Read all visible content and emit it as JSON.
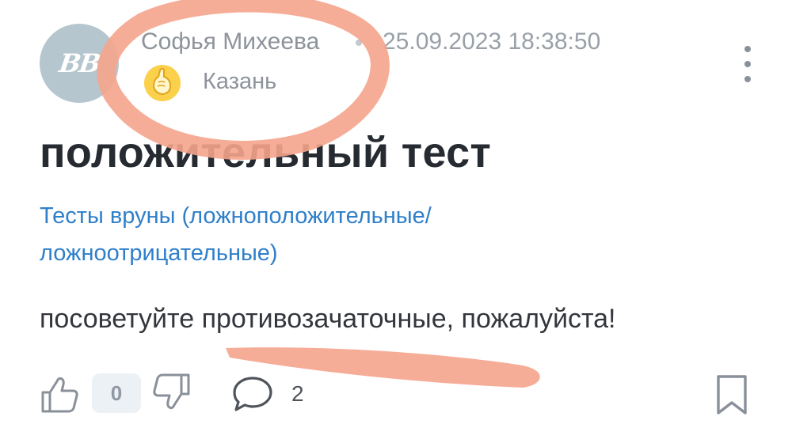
{
  "post": {
    "author": {
      "initials": "BB",
      "name": "Софья Михеева",
      "city": "Казань",
      "city_icon": "hand-emoji-icon"
    },
    "date": "25.09.2023 18:38:50",
    "title": "положительный тест",
    "category": "Тесты вруны (ложноположительные/ ложноотрицательные)",
    "body": "посоветуйте противозачаточные, пожалуйста!"
  },
  "actions": {
    "score": "0",
    "comments_count": "2",
    "icons": [
      "thumbs-up-icon",
      "thumbs-down-icon",
      "comment-icon",
      "bookmark-icon",
      "more-vertical-icon"
    ]
  },
  "colors": {
    "link": "#2f7fc9",
    "annotation": "#f5a48c",
    "avatar": "#b6c6ce"
  }
}
